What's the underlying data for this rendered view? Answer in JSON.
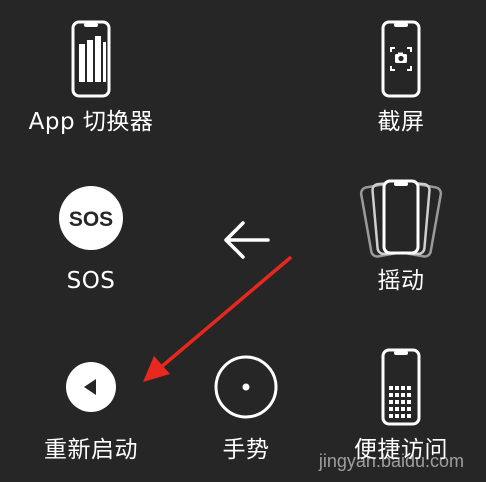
{
  "menu": {
    "items": [
      {
        "label": "App 切换器",
        "icon": "app-switcher-icon"
      },
      {
        "label": "截屏",
        "icon": "screenshot-icon"
      },
      {
        "label": "SOS",
        "icon": "sos-icon",
        "icon_text": "SOS"
      },
      {
        "label": "摇动",
        "icon": "shake-icon"
      },
      {
        "label": "重新启动",
        "icon": "restart-icon"
      },
      {
        "label": "手势",
        "icon": "gesture-icon"
      },
      {
        "label": "便捷访问",
        "icon": "reachability-icon"
      }
    ],
    "back_icon": "back-arrow-icon"
  },
  "annotation": {
    "color": "#e8281e"
  },
  "watermark": {
    "text": "jingyan.baidu.com"
  }
}
